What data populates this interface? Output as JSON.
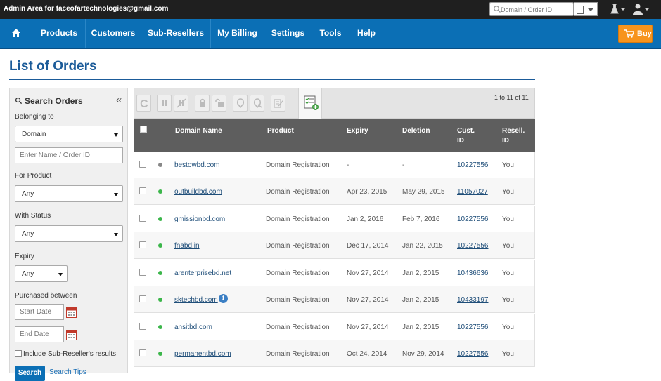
{
  "topbar": {
    "admin_text": "Admin Area for faceofartechnologies@gmail.com",
    "search_placeholder": "Domain / Order ID"
  },
  "nav": {
    "items": [
      {
        "label": "Products"
      },
      {
        "label": "Customers"
      },
      {
        "label": "Sub-Resellers"
      },
      {
        "label": "My Billing"
      },
      {
        "label": "Settings"
      },
      {
        "label": "Tools"
      },
      {
        "label": "Help"
      }
    ],
    "buy_label": "Buy"
  },
  "page": {
    "title": "List of Orders"
  },
  "search_panel": {
    "heading": "Search Orders",
    "collapse_glyph": "«",
    "belonging_label": "Belonging to",
    "belonging_value": "Domain",
    "name_placeholder": "Enter Name / Order ID",
    "product_label": "For Product",
    "product_value": "Any",
    "status_label": "With Status",
    "status_value": "Any",
    "expiry_label": "Expiry",
    "expiry_value": "Any",
    "purchased_label": "Purchased between",
    "start_placeholder": "Start Date",
    "end_placeholder": "End Date",
    "include_label": "Include Sub-Reseller's results",
    "search_button": "Search",
    "search_tips": "Search Tips"
  },
  "table": {
    "pagination": "1 to 11 of 11",
    "headers": {
      "domain": "Domain Name",
      "product": "Product",
      "expiry": "Expiry",
      "deletion": "Deletion",
      "custid_1": "Cust.",
      "custid_2": "ID",
      "resell_1": "Resell.",
      "resell_2": "ID"
    },
    "rows": [
      {
        "domain": "bestowbd.com",
        "product": "Domain Registration",
        "expiry": "-",
        "deletion": "-",
        "cust_id": "10227556",
        "resell_id": "You",
        "status": "grey"
      },
      {
        "domain": "outbuildbd.com",
        "product": "Domain Registration",
        "expiry": "Apr 23, 2015",
        "deletion": "May 29, 2015",
        "cust_id": "11057027",
        "resell_id": "You",
        "status": "green"
      },
      {
        "domain": "gmissionbd.com",
        "product": "Domain Registration",
        "expiry": "Jan 2, 2016",
        "deletion": "Feb 7, 2016",
        "cust_id": "10227556",
        "resell_id": "You",
        "status": "green"
      },
      {
        "domain": "fnabd.in",
        "product": "Domain Registration",
        "expiry": "Dec 17, 2014",
        "deletion": "Jan 22, 2015",
        "cust_id": "10227556",
        "resell_id": "You",
        "status": "green"
      },
      {
        "domain": "arenterprisebd.net",
        "product": "Domain Registration",
        "expiry": "Nov 27, 2014",
        "deletion": "Jan 2, 2015",
        "cust_id": "10436636",
        "resell_id": "You",
        "status": "green"
      },
      {
        "domain": "sktechbd.com",
        "product": "Domain Registration",
        "expiry": "Nov 27, 2014",
        "deletion": "Jan 2, 2015",
        "cust_id": "10433197",
        "resell_id": "You",
        "status": "green",
        "info": "i"
      },
      {
        "domain": "ansitbd.com",
        "product": "Domain Registration",
        "expiry": "Nov 27, 2014",
        "deletion": "Jan 2, 2015",
        "cust_id": "10227556",
        "resell_id": "You",
        "status": "green"
      },
      {
        "domain": "permanentbd.com",
        "product": "Domain Registration",
        "expiry": "Oct 24, 2014",
        "deletion": "Nov 29, 2014",
        "cust_id": "10227556",
        "resell_id": "You",
        "status": "green"
      }
    ]
  }
}
